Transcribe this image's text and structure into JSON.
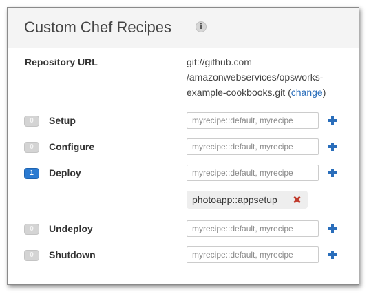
{
  "panel": {
    "title": "Custom Chef Recipes",
    "info_glyph": "i"
  },
  "repository": {
    "label": "Repository URL",
    "url_line1": "git://github.com",
    "url_line2": "/amazonwebservices/opsworks-",
    "url_line3_prefix": "example-cookbooks.git (",
    "change_label": "change",
    "url_line3_suffix": ")"
  },
  "events": [
    {
      "label": "Setup",
      "count": "0",
      "placeholder": "myrecipe::default, myrecipe",
      "active": false,
      "add_icon": "plus-icon"
    },
    {
      "label": "Configure",
      "count": "0",
      "placeholder": "myrecipe::default, myrecipe",
      "active": false,
      "add_icon": "plus-icon"
    },
    {
      "label": "Deploy",
      "count": "1",
      "placeholder": "myrecipe::default, myrecipe",
      "active": true,
      "add_icon": "plus-icon"
    },
    {
      "label": "Undeploy",
      "count": "0",
      "placeholder": "myrecipe::default, myrecipe",
      "active": false,
      "add_icon": "plus-icon"
    },
    {
      "label": "Shutdown",
      "count": "0",
      "placeholder": "myrecipe::default, myrecipe",
      "active": false,
      "add_icon": "plus-icon"
    }
  ],
  "deploy_recipes": [
    {
      "name": "photoapp::appsetup",
      "remove_icon": "remove-x-icon"
    }
  ],
  "colors": {
    "accent": "#2a6ebb",
    "badge_active": "#2a7ad1",
    "badge_inactive": "#d4d4d4",
    "remove": "#c0392b"
  }
}
